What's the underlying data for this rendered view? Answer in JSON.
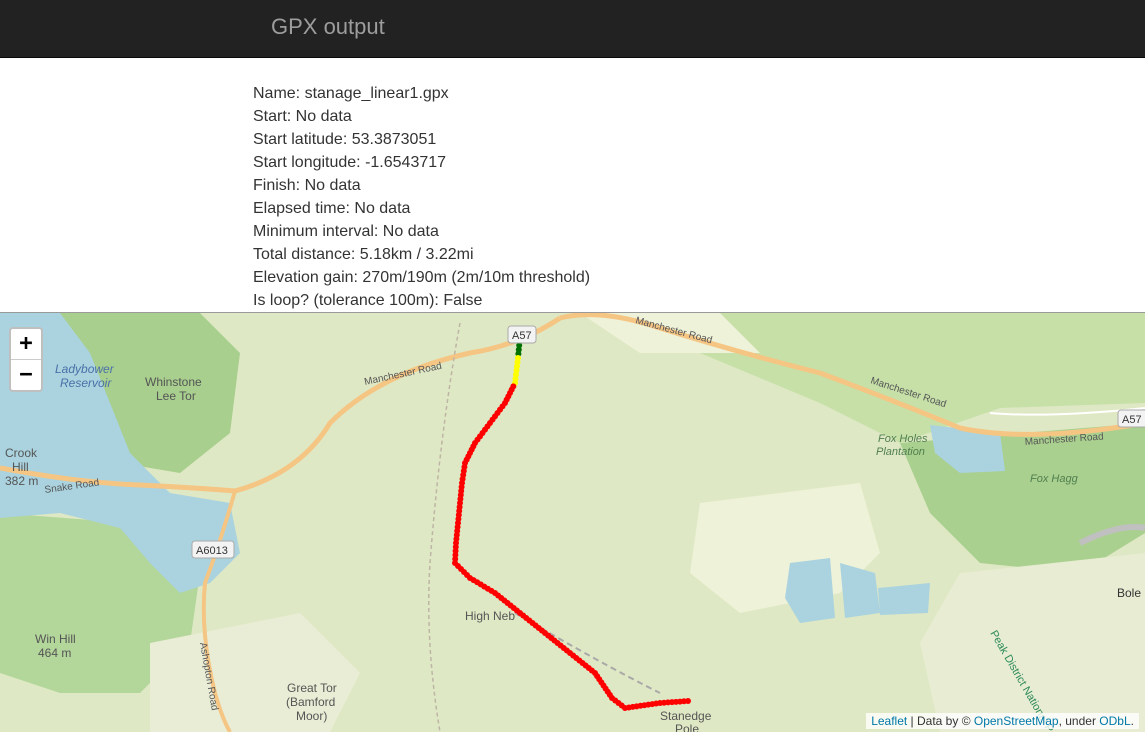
{
  "navbar": {
    "brand": "GPX output"
  },
  "info": [
    "Name: stanage_linear1.gpx",
    "Start: No data",
    "Start latitude: 53.3873051",
    "Start longitude: -1.6543717",
    "Finish: No data",
    "Elapsed time: No data",
    "Minimum interval: No data",
    "Total distance: 5.18km / 3.22mi",
    "Elevation gain: 270m/190m (2m/10m threshold)",
    "Is loop? (tolerance 100m): False"
  ],
  "map": {
    "zoom_in": "+",
    "zoom_out": "−",
    "labels": {
      "ladybower": "Ladybower",
      "reservoir": "Reservoir",
      "whinstone": "Whinstone",
      "lee_tor": "Lee Tor",
      "crook": "Crook",
      "hill": "Hill",
      "crook_elev": "382 m",
      "snake_road": "Snake Road",
      "a6013": "A6013",
      "win_hill": "Win Hill",
      "win_elev": "464 m",
      "ashopton_road": "Ashopton Road",
      "manchester_road_1": "Manchester Road",
      "manchester_road_2": "Manchester Road",
      "manchester_road_3": "Manchester Road",
      "manchester_road_4": "Manchester Road",
      "a57": "A57",
      "a57_2": "A57",
      "fox_holes": "Fox Holes",
      "plantation": "Plantation",
      "fox_hagg": "Fox Hagg",
      "high_neb": "High Neb",
      "great_tor": "Great Tor",
      "bamford": "(Bamford",
      "moor": "Moor)",
      "stanedge": "Stanedge",
      "pole": "Pole",
      "peak_district": "Peak District National P",
      "bole": "Bole"
    },
    "colors": {
      "start": "#007000",
      "mid": "#ffff00",
      "track": "#ff0000"
    },
    "attribution": {
      "leaflet": "Leaflet",
      "sep1": " | Data by © ",
      "osm": "OpenStreetMap",
      "sep2": ", under ",
      "odbl": "ODbL",
      "end": "."
    }
  }
}
